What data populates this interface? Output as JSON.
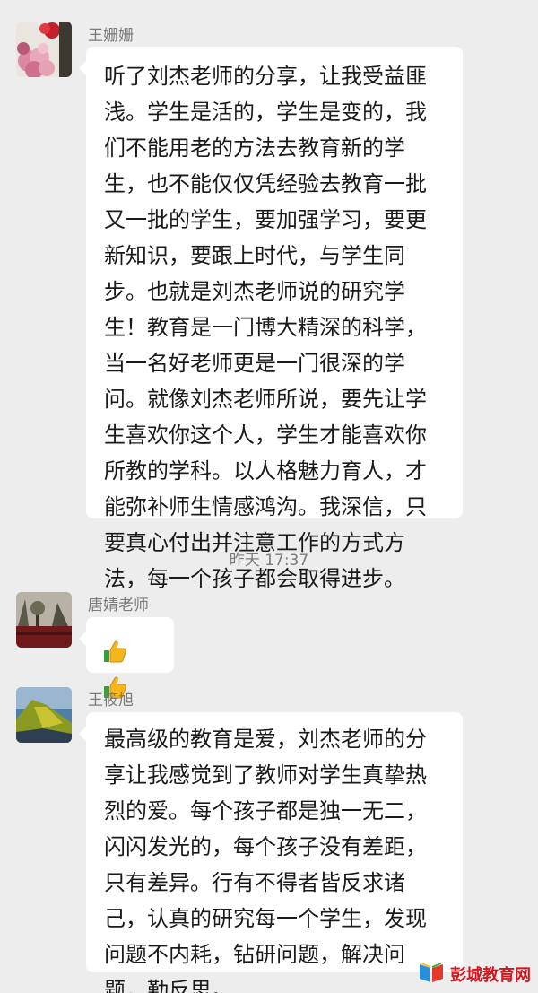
{
  "messages": [
    {
      "sender": "王姗姗",
      "lines": [
        "听了刘杰老师的分享，让我受益匪",
        "浅。学生是活的，学生是变的，我",
        "们不能用老的方法去教育新的学",
        "生，也不能仅仅凭经验去教育一批",
        "又一批的学生，要加强学习，要更",
        "新知识，要跟上时代，与学生同",
        "步。也就是刘杰老师说的研究学",
        "生！教育是一门博大精深的科学，",
        "当一名好老师更是一门很深的学",
        "问。就像刘杰老师所说，要先让学",
        "生喜欢你这个人，学生才能喜欢你",
        "所教的学科。以人格魅力育人，才",
        "能弥补师生情感鸿沟。我深信，只",
        "要真心付出并注意工作的方式方",
        "法，每一个孩子都会取得进步。"
      ]
    },
    {
      "sender": "唐婧老师",
      "emoji": [
        "thumbs-up",
        "thumbs-up"
      ]
    },
    {
      "sender": "王筱旭",
      "lines": [
        "最高级的教育是爱，刘杰老师的分",
        "享让我感觉到了教师对学生真挚热",
        "烈的爱。每个孩子都是独一无二，",
        "闪闪发光的，每个孩子没有差距，",
        "只有差异。行有不得者皆反求诸",
        "己，认真的研究每一个学生，发现",
        "问题不内耗，钻研问题，解决问",
        "题，勤反思。"
      ]
    }
  ],
  "timestamp": "昨天 17:37",
  "watermark": {
    "text": "彭城教育网"
  },
  "colors": {
    "background": "#ededed",
    "bubble": "#ffffff",
    "meta_text": "#7b7b7b",
    "watermark": "#d5141c"
  }
}
